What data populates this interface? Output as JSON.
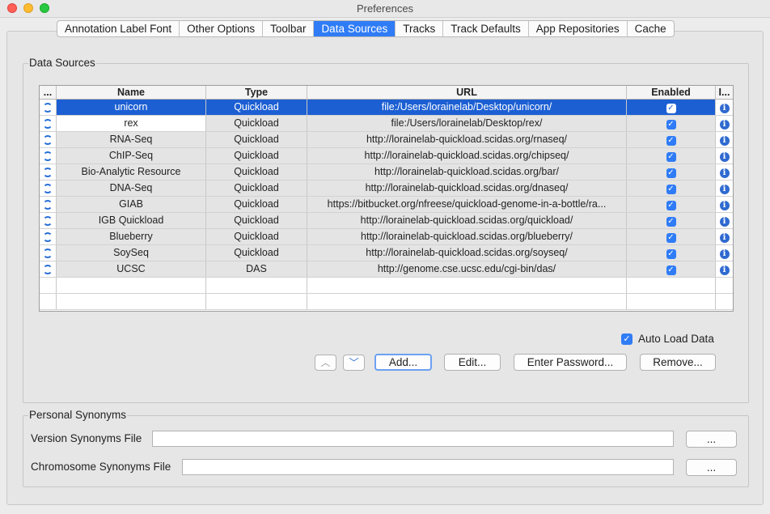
{
  "window": {
    "title": "Preferences"
  },
  "tabs": [
    {
      "label": "Annotation Label Font"
    },
    {
      "label": "Other Options"
    },
    {
      "label": "Toolbar"
    },
    {
      "label": "Data Sources"
    },
    {
      "label": "Tracks"
    },
    {
      "label": "Track Defaults"
    },
    {
      "label": "App Repositories"
    },
    {
      "label": "Cache"
    }
  ],
  "active_tab": "Data Sources",
  "data_sources": {
    "group_title": "Data Sources",
    "columns": {
      "icon": "...",
      "name": "Name",
      "type": "Type",
      "url": "URL",
      "enabled": "Enabled",
      "info": "I..."
    },
    "rows": [
      {
        "name": "unicorn",
        "type": "Quickload",
        "url": "file:/Users/lorainelab/Desktop/unicorn/",
        "enabled": true,
        "selected": true
      },
      {
        "name": "rex",
        "type": "Quickload",
        "url": "file:/Users/lorainelab/Desktop/rex/",
        "enabled": true
      },
      {
        "name": "RNA-Seq",
        "type": "Quickload",
        "url": "http://lorainelab-quickload.scidas.org/rnaseq/",
        "enabled": true
      },
      {
        "name": "ChIP-Seq",
        "type": "Quickload",
        "url": "http://lorainelab-quickload.scidas.org/chipseq/",
        "enabled": true
      },
      {
        "name": "Bio-Analytic Resource",
        "type": "Quickload",
        "url": "http://lorainelab-quickload.scidas.org/bar/",
        "enabled": true
      },
      {
        "name": "DNA-Seq",
        "type": "Quickload",
        "url": "http://lorainelab-quickload.scidas.org/dnaseq/",
        "enabled": true
      },
      {
        "name": "GIAB",
        "type": "Quickload",
        "url": "https://bitbucket.org/nfreese/quickload-genome-in-a-bottle/ra...",
        "enabled": true
      },
      {
        "name": "IGB Quickload",
        "type": "Quickload",
        "url": "http://lorainelab-quickload.scidas.org/quickload/",
        "enabled": true
      },
      {
        "name": "Blueberry",
        "type": "Quickload",
        "url": "http://lorainelab-quickload.scidas.org/blueberry/",
        "enabled": true
      },
      {
        "name": "SoySeq",
        "type": "Quickload",
        "url": "http://lorainelab-quickload.scidas.org/soyseq/",
        "enabled": true
      },
      {
        "name": "UCSC",
        "type": "DAS",
        "url": "http://genome.cse.ucsc.edu/cgi-bin/das/",
        "enabled": true
      }
    ],
    "auto_load_label": "Auto Load Data",
    "auto_load_checked": true,
    "buttons": {
      "add": "Add...",
      "edit": "Edit...",
      "enter_password": "Enter Password...",
      "remove": "Remove..."
    }
  },
  "personal_synonyms": {
    "group_title": "Personal Synonyms",
    "version_label": "Version Synonyms File",
    "version_value": "",
    "chromosome_label": "Chromosome Synonyms File",
    "chromosome_value": "",
    "browse_label": "..."
  },
  "colors": {
    "accent": "#2f7cf6",
    "selection": "#1c5fd3"
  }
}
